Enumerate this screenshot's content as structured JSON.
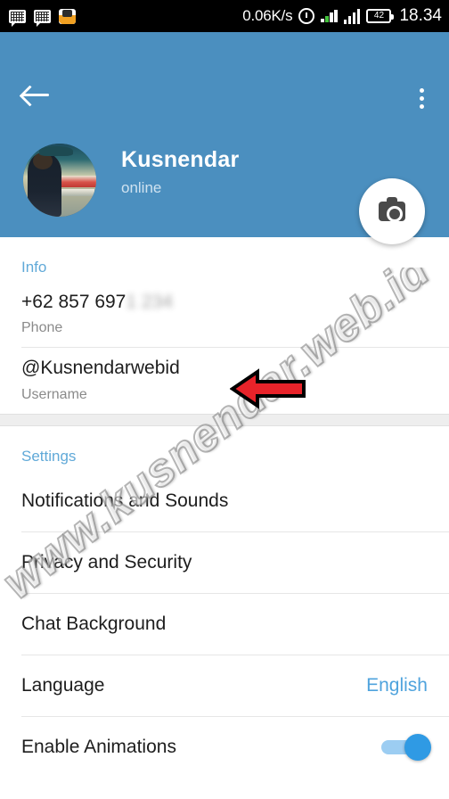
{
  "statusbar": {
    "network_speed": "0.06K/s",
    "battery_level": "42",
    "clock": "18.34",
    "icons": [
      "message-icon",
      "message-icon",
      "app-icon",
      "alarm-icon",
      "signal-bars-icon",
      "signal-bars-icon",
      "battery-icon"
    ]
  },
  "header": {
    "back_icon": "back-arrow-icon",
    "menu_icon": "overflow-menu-icon",
    "profile_name": "Kusnendar",
    "profile_status": "online",
    "fab_icon": "camera-icon",
    "background_color": "#4b8fbf"
  },
  "info": {
    "title": "Info",
    "rows": [
      {
        "value": "+62 857 697",
        "masked_suffix": "1 234",
        "label": "Phone"
      },
      {
        "value": "@Kusnendarwebid",
        "masked_suffix": "",
        "label": "Username"
      }
    ]
  },
  "settings": {
    "title": "Settings",
    "rows": [
      {
        "label": "Notifications and Sounds",
        "value": "",
        "control": "none"
      },
      {
        "label": "Privacy and Security",
        "value": "",
        "control": "none"
      },
      {
        "label": "Chat Background",
        "value": "",
        "control": "none"
      },
      {
        "label": "Language",
        "value": "English",
        "control": "value"
      },
      {
        "label": "Enable Animations",
        "value": "",
        "control": "toggle-on"
      }
    ]
  },
  "annotation": {
    "arrow_color": "#e8232a",
    "arrow_outline": "#000000",
    "arrow_direction": "left",
    "points_at": "Username"
  },
  "watermark": {
    "text": "www.kusnendar.web.id"
  },
  "colors": {
    "accent_blue": "#4fa3dd",
    "header_blue": "#4b8fbf",
    "section_title_blue": "#60a9d8",
    "toggle_on": "#2f9ae4"
  }
}
